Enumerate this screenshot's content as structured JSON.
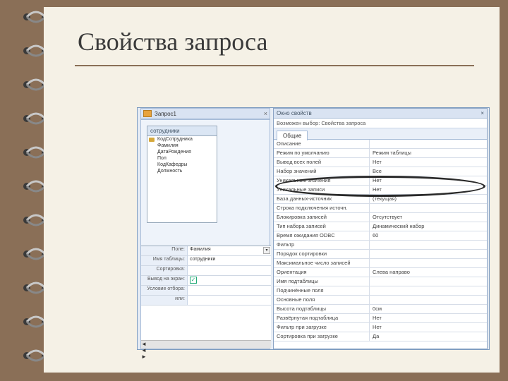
{
  "slide": {
    "title": "Свойства запроса"
  },
  "query": {
    "tab": "Запрос1",
    "close": "×"
  },
  "table": {
    "name": "сотрудники",
    "fields": [
      "КодСотрудника",
      "Фамилия",
      "ДатаРождения",
      "Пол",
      "КодКафедры",
      "Должность"
    ]
  },
  "grid": {
    "rows": [
      {
        "label": "Поле:",
        "value": "Фамилия",
        "dd": true
      },
      {
        "label": "Имя таблицы:",
        "value": "сотрудники"
      },
      {
        "label": "Сортировка:",
        "value": ""
      },
      {
        "label": "Вывод на экран:",
        "value": "",
        "check": true
      },
      {
        "label": "Условие отбора:",
        "value": ""
      },
      {
        "label": "или:",
        "value": ""
      }
    ]
  },
  "properties": {
    "title": "Окно свойств",
    "close": "×",
    "subtitle": "Возможен выбор: Свойства запроса",
    "tab": "Общие",
    "rows": [
      {
        "n": "Описание",
        "v": ""
      },
      {
        "n": "Режим по умолчанию",
        "v": "Режим таблицы"
      },
      {
        "n": "Вывод всех полей",
        "v": "Нет"
      },
      {
        "n": "Набор значений",
        "v": "Все"
      },
      {
        "n": "Уникальные значения",
        "v": "Нет"
      },
      {
        "n": "Уникальные записи",
        "v": "Нет"
      },
      {
        "n": "База данных-источник",
        "v": "(текущая)"
      },
      {
        "n": "Строка подключения источн.",
        "v": ""
      },
      {
        "n": "Блокировка записей",
        "v": "Отсутствует"
      },
      {
        "n": "Тип набора записей",
        "v": "Динамический набор"
      },
      {
        "n": "Время ожидания ODBC",
        "v": "60"
      },
      {
        "n": "Фильтр",
        "v": ""
      },
      {
        "n": "Порядок сортировки",
        "v": ""
      },
      {
        "n": "Максимальное число записей",
        "v": ""
      },
      {
        "n": "Ориентация",
        "v": "Слева направо"
      },
      {
        "n": "Имя подтаблицы",
        "v": ""
      },
      {
        "n": "Подчинённые поля",
        "v": ""
      },
      {
        "n": "Основные поля",
        "v": ""
      },
      {
        "n": "Высота подтаблицы",
        "v": "0см"
      },
      {
        "n": "Развёрнутая подтаблица",
        "v": "Нет"
      },
      {
        "n": "Фильтр при загрузке",
        "v": "Нет"
      },
      {
        "n": "Сортировка при загрузке",
        "v": "Да"
      }
    ]
  }
}
